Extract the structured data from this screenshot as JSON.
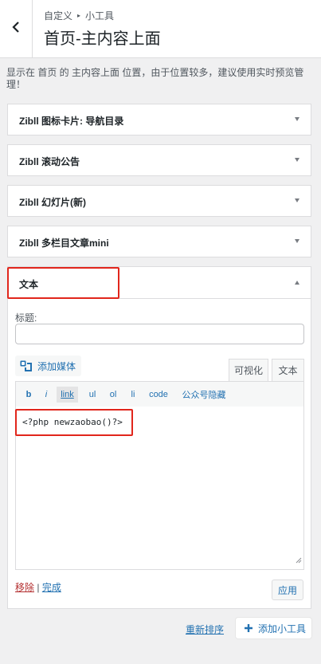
{
  "header": {
    "breadcrumb_parent": "自定义",
    "breadcrumb_child": "小工具",
    "title": "首页-主内容上面"
  },
  "description": "显示在 首页 的 主内容上面 位置，由于位置较多，建议使用实时预览管理！",
  "collapsed_widgets": [
    {
      "label": "Zibll 图标卡片: 导航目录"
    },
    {
      "label": "Zibll 滚动公告"
    },
    {
      "label": "Zibll 幻灯片(新)"
    },
    {
      "label": "Zibll 多栏目文章mini"
    }
  ],
  "text_widget": {
    "title": "文本",
    "field_label": "标题:",
    "title_value": "",
    "add_media": "添加媒体",
    "tab_visual": "可视化",
    "tab_text": "文本",
    "quicktags": [
      "b",
      "i",
      "link",
      "ul",
      "ol",
      "li",
      "code",
      "公众号隐藏"
    ],
    "active_quicktag": "link",
    "content": "<?php newzaobao()?>",
    "delete_label": "移除",
    "separator": "|",
    "done_label": "完成",
    "apply_label": "应用"
  },
  "footer": {
    "reorder_label": "重新排序",
    "add_widget_label": "添加小工具"
  },
  "colors": {
    "accent": "#2271b1",
    "danger": "#b32d2e",
    "highlight_box": "#e1261c"
  },
  "icons": {
    "back": "chevron-left-icon",
    "media": "media-icon",
    "add": "plus-icon"
  }
}
